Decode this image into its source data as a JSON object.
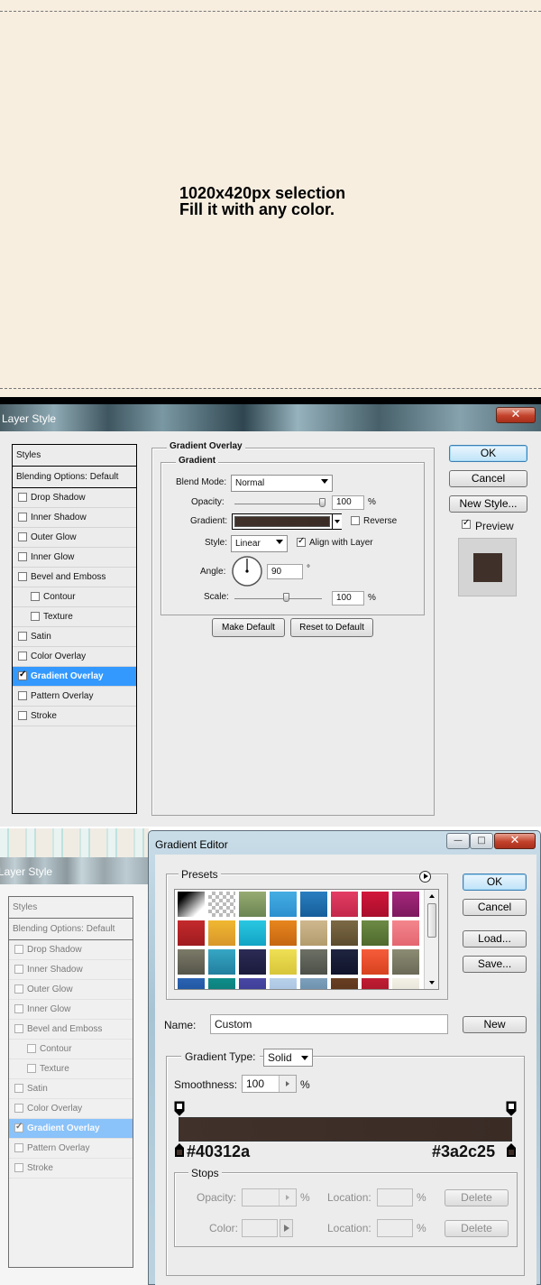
{
  "canvas": {
    "line1": "1020x420px selection",
    "line2": "Fill it with any color."
  },
  "layer_style": {
    "title": "Layer Style",
    "close_glyph": "✕",
    "styles_header": "Styles",
    "blending_options": "Blending Options: Default",
    "items": [
      {
        "label": "Drop Shadow",
        "checked": false
      },
      {
        "label": "Inner Shadow",
        "checked": false
      },
      {
        "label": "Outer Glow",
        "checked": false
      },
      {
        "label": "Inner Glow",
        "checked": false
      },
      {
        "label": "Bevel and Emboss",
        "checked": false
      },
      {
        "label": "Contour",
        "checked": false
      },
      {
        "label": "Texture",
        "checked": false
      },
      {
        "label": "Satin",
        "checked": false
      },
      {
        "label": "Color Overlay",
        "checked": false
      },
      {
        "label": "Gradient Overlay",
        "checked": true
      },
      {
        "label": "Pattern Overlay",
        "checked": false
      },
      {
        "label": "Stroke",
        "checked": false
      }
    ],
    "group_title": "Gradient Overlay",
    "subgroup_title": "Gradient",
    "blend_mode_label": "Blend Mode:",
    "blend_mode_value": "Normal",
    "opacity_label": "Opacity:",
    "opacity_value": "100",
    "opacity_unit": "%",
    "gradient_label": "Gradient:",
    "reverse_label": "Reverse",
    "style_label": "Style:",
    "style_value": "Linear",
    "align_label": "Align with Layer",
    "angle_label": "Angle:",
    "angle_value": "90",
    "angle_unit": "°",
    "scale_label": "Scale:",
    "scale_value": "100",
    "scale_unit": "%",
    "make_default": "Make Default",
    "reset_default": "Reset to Default",
    "ok": "OK",
    "cancel": "Cancel",
    "new_style": "New Style...",
    "preview_label": "Preview",
    "preview_color": "#3f302a",
    "opacity_fraction": 1.0,
    "scale_fraction": 0.6
  },
  "gradient_editor": {
    "title": "Gradient Editor",
    "presets_label": "Presets",
    "name_label": "Name:",
    "name_value": "Custom",
    "new_button": "New",
    "ok": "OK",
    "cancel": "Cancel",
    "load": "Load...",
    "save": "Save...",
    "gradient_type_label": "Gradient Type:",
    "gradient_type_value": "Solid",
    "smoothness_label": "Smoothness:",
    "smoothness_value": "100",
    "smoothness_unit": "%",
    "left_color": "#40312a",
    "right_color": "#3a2c25",
    "stops_label": "Stops",
    "opacity_label": "Opacity:",
    "color_label": "Color:",
    "location_label": "Location:",
    "percent": "%",
    "delete": "Delete",
    "min_glyph": "—",
    "max_glyph": "□",
    "close_glyph": "✕"
  },
  "colors": {
    "selection_bg": "#3399ff",
    "gradient_start": "#40312a",
    "gradient_end": "#3a2c25",
    "canvas_bg": "#f7eee0"
  }
}
